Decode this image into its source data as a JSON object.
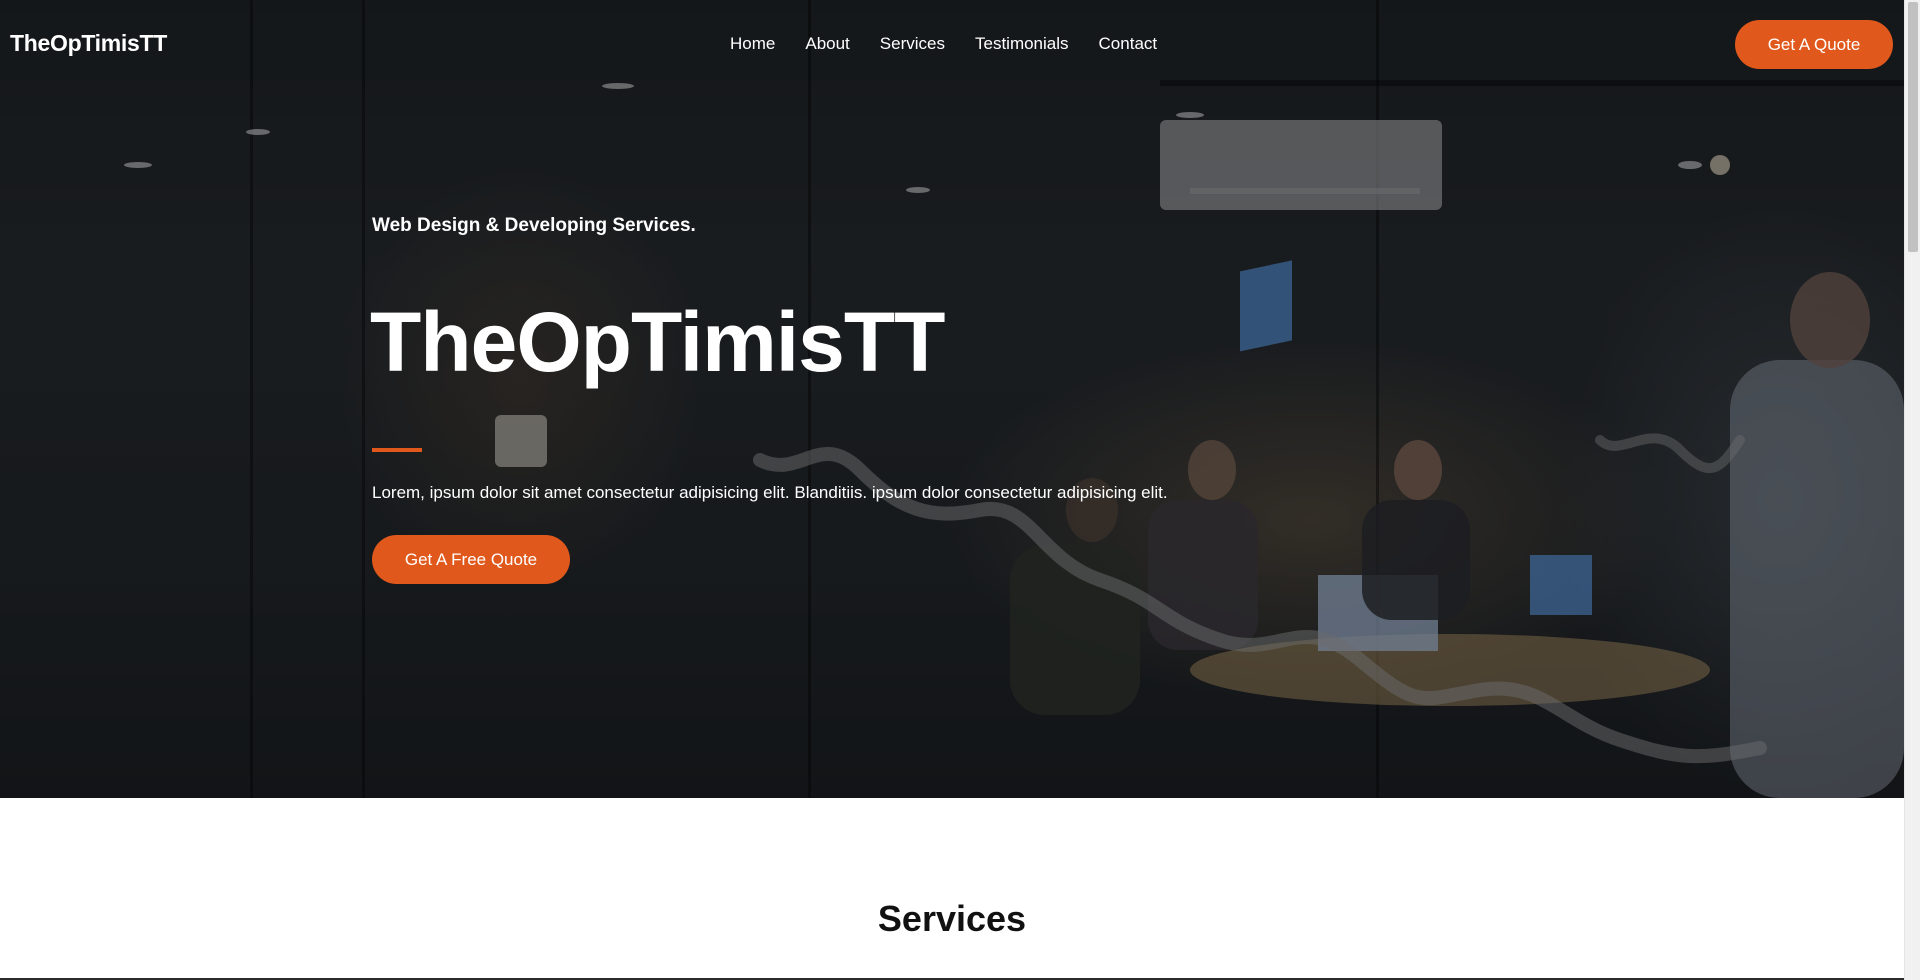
{
  "brand": {
    "logo_text": "TheOpTimisTT"
  },
  "nav": {
    "items": [
      {
        "label": "Home"
      },
      {
        "label": "About"
      },
      {
        "label": "Services"
      },
      {
        "label": "Testimonials"
      },
      {
        "label": "Contact"
      }
    ],
    "cta_label": "Get A Quote"
  },
  "hero": {
    "subtitle": "Web Design & Developing Services.",
    "title": "TheOpTimisTT",
    "description": "Lorem, ipsum dolor sit amet consectetur adipisicing elit. Blanditiis. ipsum dolor consectetur adipisicing elit.",
    "cta_label": "Get A Free Quote"
  },
  "services": {
    "heading": "Services"
  },
  "colors": {
    "accent": "#e0581b",
    "overlay": "#1b1e21",
    "background": "#ffffff"
  }
}
